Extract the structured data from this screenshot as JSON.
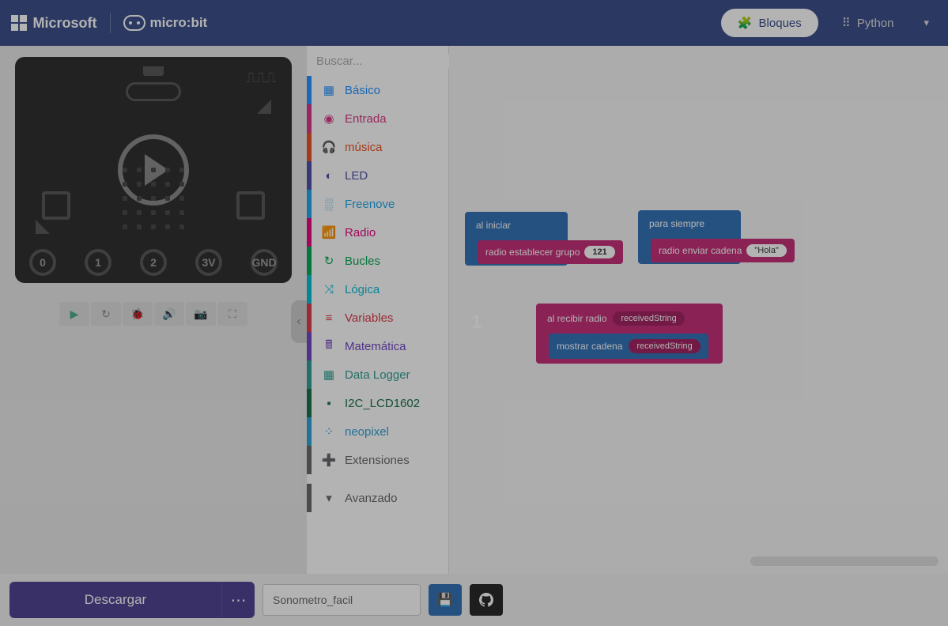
{
  "header": {
    "ms_label": "Microsoft",
    "microbit_label": "micro:bit",
    "blocks_label": "Bloques",
    "python_label": "Python"
  },
  "search": {
    "placeholder": "Buscar..."
  },
  "categories": [
    {
      "id": "basico",
      "label": "Básico",
      "icon": "▦"
    },
    {
      "id": "entrada",
      "label": "Entrada",
      "icon": "◉"
    },
    {
      "id": "musica",
      "label": "música",
      "icon": "🎧"
    },
    {
      "id": "led",
      "label": "LED",
      "icon": "◐"
    },
    {
      "id": "freenove",
      "label": "Freenove",
      "icon": "░"
    },
    {
      "id": "radio",
      "label": "Radio",
      "icon": "📶"
    },
    {
      "id": "bucles",
      "label": "Bucles",
      "icon": "↻"
    },
    {
      "id": "logica",
      "label": "Lógica",
      "icon": "⤨"
    },
    {
      "id": "variables",
      "label": "Variables",
      "icon": "≡"
    },
    {
      "id": "matematica",
      "label": "Matemática",
      "icon": "🖩"
    },
    {
      "id": "datalogger",
      "label": "Data Logger",
      "icon": "▦"
    },
    {
      "id": "i2c",
      "label": "I2C_LCD1602",
      "icon": "▪"
    },
    {
      "id": "neopixel",
      "label": "neopixel",
      "icon": "⁘"
    },
    {
      "id": "ext",
      "label": "Extensiones",
      "icon": "➕"
    }
  ],
  "advanced_label": "Avanzado",
  "pins": [
    "0",
    "1",
    "2",
    "3V",
    "GND"
  ],
  "blocks": {
    "on_start": "al iniciar",
    "radio_set_group": "radio establecer grupo",
    "group_value": "121",
    "forever": "para siempre",
    "radio_send_string": "radio enviar cadena",
    "send_value": "\"Hola\"",
    "on_radio_received": "al recibir radio",
    "received_var": "receivedString",
    "show_string": "mostrar cadena"
  },
  "workspace_number": "1",
  "footer": {
    "download": "Descargar",
    "project_name": "Sonometro_facil"
  }
}
